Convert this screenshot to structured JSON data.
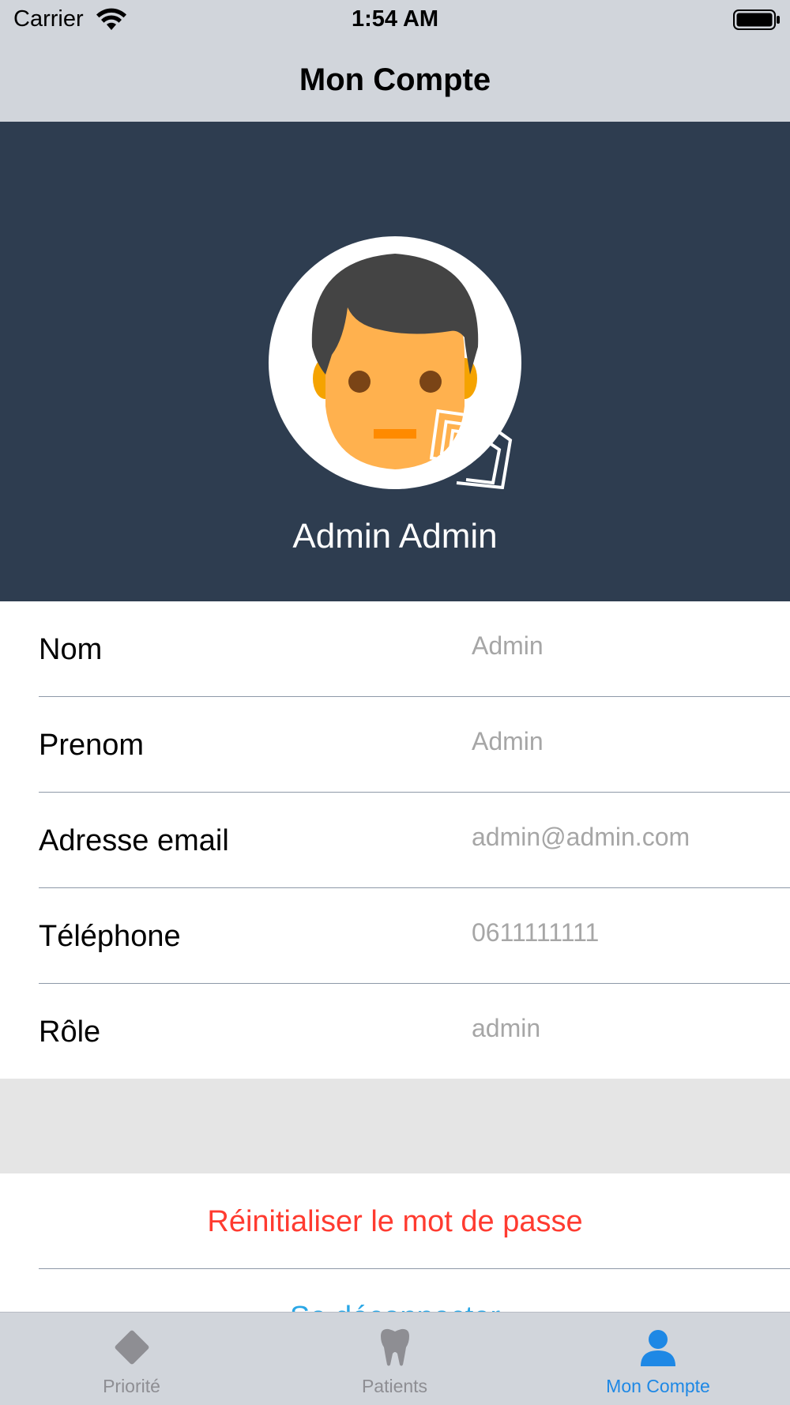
{
  "status_bar": {
    "carrier": "Carrier",
    "time": "1:54 AM",
    "wifi_icon": "wifi-icon",
    "battery_icon": "battery-icon"
  },
  "nav": {
    "title": "Mon Compte"
  },
  "profile": {
    "avatar_icon": "male-avatar-icon",
    "name": "Admin Admin",
    "header_color": "#2e3d50"
  },
  "info": {
    "rows": [
      {
        "label": "Nom",
        "value": "Admin"
      },
      {
        "label": "Prenom",
        "value": "Admin"
      },
      {
        "label": "Adresse email",
        "value": "admin@admin.com"
      },
      {
        "label": "Téléphone",
        "value": "0611111111"
      },
      {
        "label": "Rôle",
        "value": "admin"
      }
    ]
  },
  "actions": {
    "reset_password": "Réinitialiser le mot de passe",
    "logout": "Se déconnecter",
    "reset_color": "#ff3b30",
    "logout_color": "#2aa7e6"
  },
  "tabs": [
    {
      "label": "Priorité",
      "icon": "diamond-icon",
      "active": false
    },
    {
      "label": "Patients",
      "icon": "tooth-icon",
      "active": false
    },
    {
      "label": "Mon Compte",
      "icon": "person-icon",
      "active": true
    }
  ],
  "colors": {
    "active_tab": "#1e88e5",
    "inactive_tab": "#8e8e93"
  }
}
